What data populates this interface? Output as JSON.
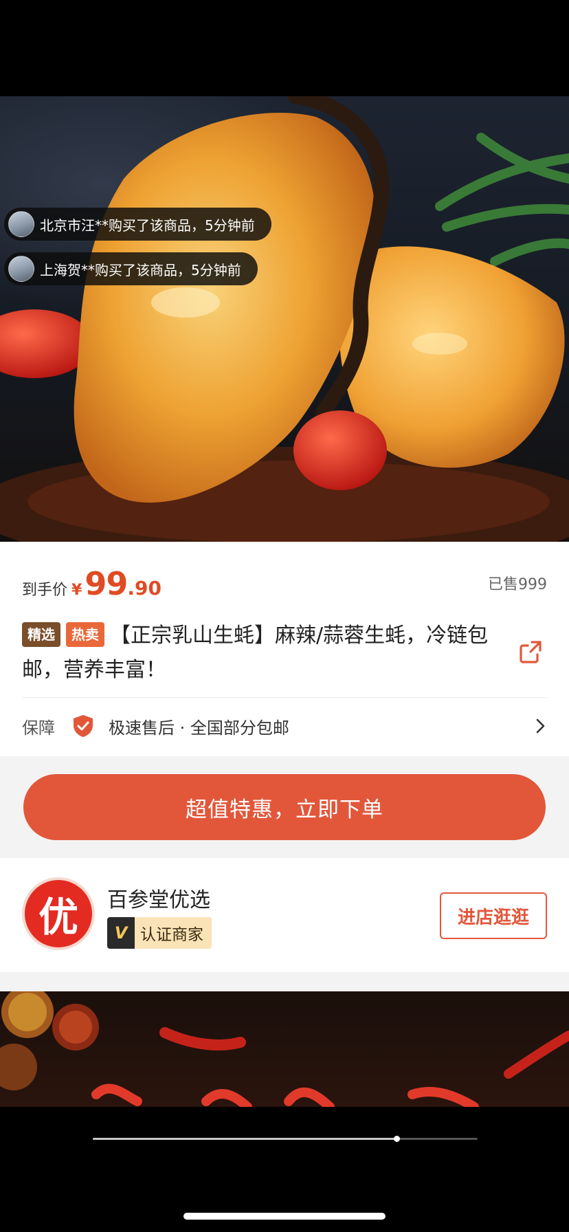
{
  "toasts": [
    {
      "text": "北京市汪**购买了该商品，5分钟前"
    },
    {
      "text": "上海贺**购买了该商品，5分钟前"
    }
  ],
  "product": {
    "price_label": "到手价",
    "currency": "¥",
    "price_int": "99",
    "price_dec": ".90",
    "sold": "已售999",
    "tags": [
      "精选",
      "热卖"
    ],
    "title": "【正宗乳山生蚝】麻辣/蒜蓉生蚝，冷链包邮，营养丰富！"
  },
  "guarantee": {
    "label": "保障",
    "text": "极速售后 · 全国部分包邮"
  },
  "buy_button": "超值特惠，立即下单",
  "shop": {
    "logo_char": "优",
    "name": "百参堂优选",
    "verified_mark": "V",
    "verified_text": "认证商家",
    "visit_button": "进店逛逛"
  },
  "video": {
    "progress": 0.79
  },
  "colors": {
    "accent": "#e2573a",
    "price": "#e04b24"
  }
}
